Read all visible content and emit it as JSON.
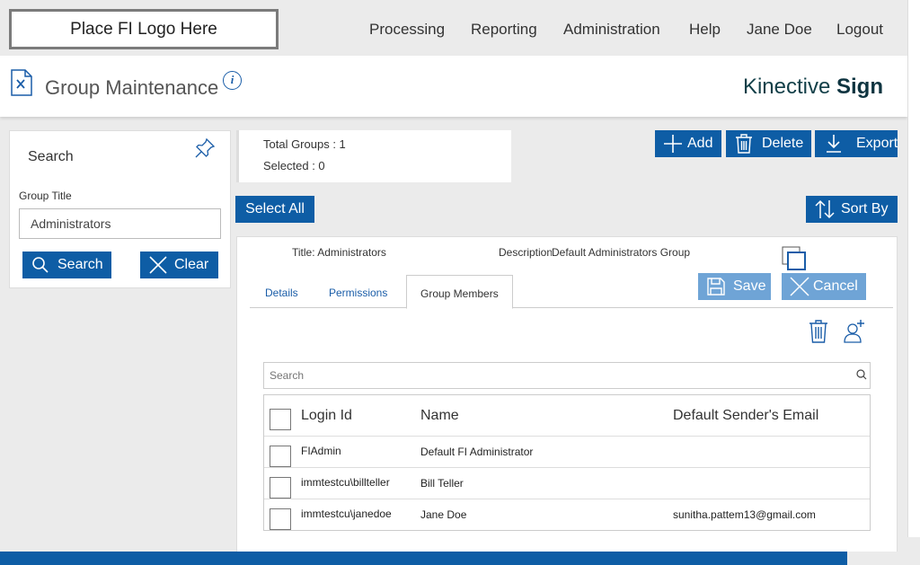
{
  "topnav": {
    "logo_text": "Place FI Logo Here",
    "links": [
      "Processing",
      "Reporting",
      "Administration",
      "Help",
      "Jane Doe",
      "Logout"
    ]
  },
  "header": {
    "title": "Group Maintenance",
    "info_icon": "info-icon",
    "brand_regular": "Kinective",
    "brand_bold": "Sign"
  },
  "search_panel": {
    "title": "Search",
    "field_label": "Group Title",
    "field_value": "Administrators",
    "search_button": "Search",
    "clear_button": "Clear"
  },
  "summary": {
    "total_groups": "Total Groups : 1",
    "selected": "Selected : 0"
  },
  "actions": {
    "add": "Add",
    "delete": "Delete",
    "export": "Export",
    "select_all": "Select All",
    "sort_by": "Sort By"
  },
  "group_detail": {
    "title": "Title: Administrators",
    "description_label": "Description",
    "description_value": "Default Administrators Group",
    "tabs": [
      "Details",
      "Permissions",
      "Group Members"
    ],
    "active_tab": "Group Members",
    "save": "Save",
    "cancel": "Cancel"
  },
  "members": {
    "search_placeholder": "Search",
    "columns": [
      "Login Id",
      "Name",
      "Default Sender's Email"
    ],
    "rows": [
      {
        "login": "FIAdmin",
        "name": "Default FI Administrator",
        "email": ""
      },
      {
        "login": "immtestcu\\billteller",
        "name": "Bill Teller",
        "email": ""
      },
      {
        "login": "immtestcu\\janedoe",
        "name": "Jane Doe",
        "email": "sunitha.pattem13@gmail.com"
      }
    ]
  },
  "colors": {
    "primary_blue": "#0e5da5",
    "disabled_blue": "#6fa4d6",
    "brand_text": "#123f48"
  }
}
